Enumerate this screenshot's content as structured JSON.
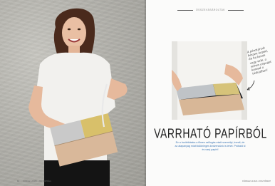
{
  "right_page": {
    "section_tag": "ÖSSZEVÁSÁROLTÁK",
    "title": "VARRHATÓ PAPÍRBÓL",
    "lead": "Ez a borítéktáska a filmes csillogás miatt személyt, trendi, de az alapanyag miatt különleges kedvencünk is lehet. Próbáld ki és varrj papírt!",
    "note": "A pénztárcát készen kapod, de ha kevés vagy vele, a színes anyagot keresd a táskádhoz!",
    "footer": "FÜRGE UJJAK • FOLYÓIRAT"
  },
  "left_page": {
    "page_number": "14",
    "footer": "FÜRGE UJJAK • BÁTORSÁG"
  },
  "colors": {
    "lead_text": "#3a75b5",
    "silver": "#c9c9c9",
    "gold": "#d8c06a",
    "rose_gold": "#d9b89a",
    "blouse": "#f2f1ee"
  }
}
